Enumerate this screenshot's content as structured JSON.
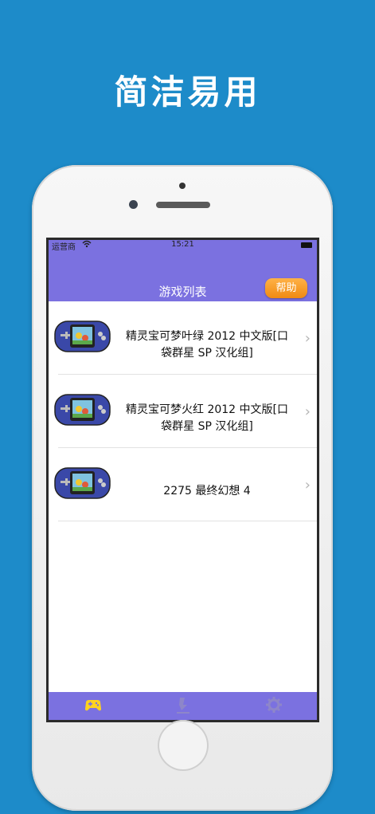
{
  "headline": "简洁易用",
  "status": {
    "carrier": "运营商",
    "time": "15:21"
  },
  "nav": {
    "title": "游戏列表",
    "help_label": "帮助"
  },
  "games": [
    {
      "line1": "精灵宝可梦叶绿 2012 中文版[口",
      "line2": "袋群星 SP 汉化组]"
    },
    {
      "line1": "精灵宝可梦火红 2012 中文版[口",
      "line2": "袋群星 SP 汉化组]"
    },
    {
      "line1": "2275 最终幻想 4",
      "line2": ""
    }
  ],
  "tabs": [
    {
      "icon": "gamepad-icon",
      "active": true
    },
    {
      "icon": "download-icon",
      "active": false
    },
    {
      "icon": "gear-icon",
      "active": false
    }
  ],
  "colors": {
    "background": "#1d8bc9",
    "bar": "#7b71e0",
    "help": "#f59a20",
    "active_tab": "#ffd21f",
    "inactive_tab": "#8e86c9"
  }
}
